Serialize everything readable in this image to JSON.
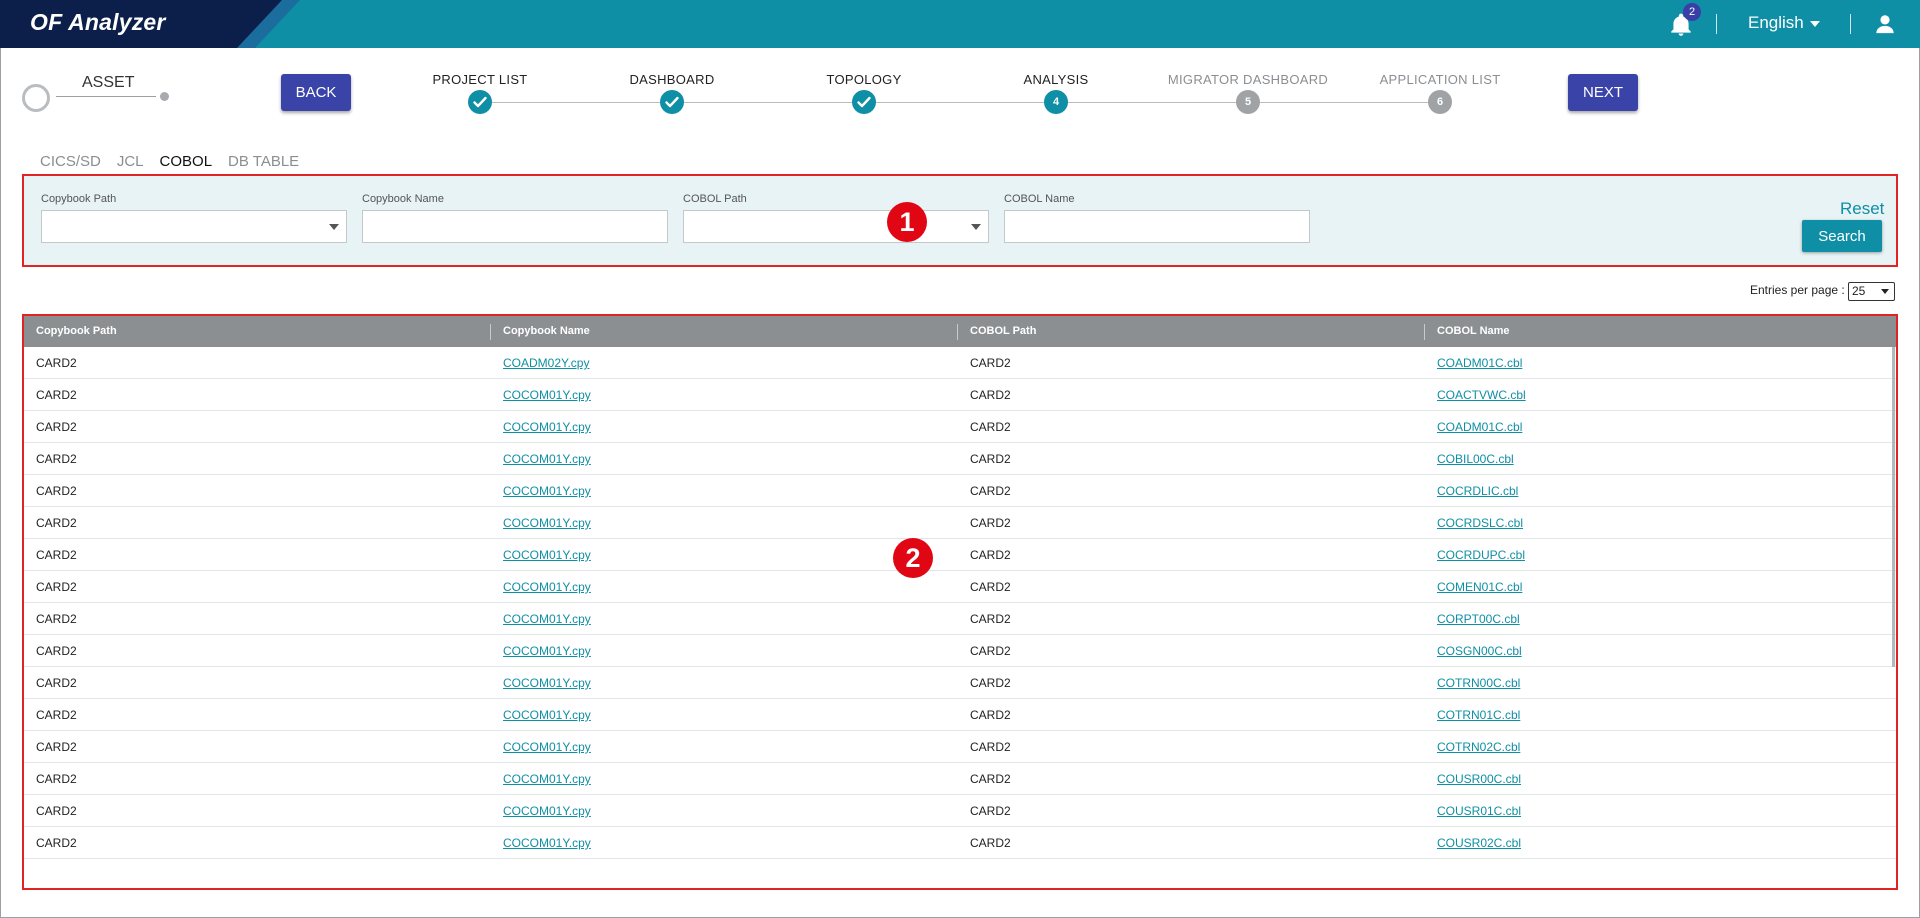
{
  "header": {
    "app_title": "OF Analyzer",
    "notification_count": "2",
    "language": "English",
    "colors": {
      "header_bg": "#0e8fa5",
      "logo_bg": "#0c1f4a",
      "accent": "#0e8fa5",
      "button": "#3a44a8"
    }
  },
  "nav": {
    "asset_label": "ASSET",
    "back_label": "BACK",
    "next_label": "NEXT",
    "steps": [
      {
        "label": "PROJECT LIST",
        "state": "done",
        "mark": ""
      },
      {
        "label": "DASHBOARD",
        "state": "done",
        "mark": ""
      },
      {
        "label": "TOPOLOGY",
        "state": "done",
        "mark": ""
      },
      {
        "label": "ANALYSIS",
        "state": "active",
        "mark": "4"
      },
      {
        "label": "MIGRATOR DASHBOARD",
        "state": "pending",
        "mark": "5"
      },
      {
        "label": "APPLICATION LIST",
        "state": "pending",
        "mark": "6"
      }
    ]
  },
  "tabs": [
    "CICS/SD",
    "JCL",
    "COBOL",
    "DB TABLE"
  ],
  "active_tab": "COBOL",
  "filter": {
    "copybook_path_label": "Copybook Path",
    "copybook_path_value": "",
    "copybook_name_label": "Copybook Name",
    "copybook_name_value": "",
    "cobol_path_label": "COBOL Path",
    "cobol_path_value": "",
    "cobol_name_label": "COBOL Name",
    "cobol_name_value": "",
    "reset_label": "Reset",
    "search_label": "Search"
  },
  "markers": {
    "filter": "1",
    "table": "2"
  },
  "entries": {
    "label": "Entries per page :",
    "value": "25"
  },
  "table": {
    "columns": [
      "Copybook Path",
      "Copybook Name",
      "COBOL Path",
      "COBOL Name"
    ],
    "rows": [
      [
        "CARD2",
        "COADM02Y.cpy",
        "CARD2",
        "COADM01C.cbl"
      ],
      [
        "CARD2",
        "COCOM01Y.cpy",
        "CARD2",
        "COACTVWC.cbl"
      ],
      [
        "CARD2",
        "COCOM01Y.cpy",
        "CARD2",
        "COADM01C.cbl"
      ],
      [
        "CARD2",
        "COCOM01Y.cpy",
        "CARD2",
        "COBIL00C.cbl"
      ],
      [
        "CARD2",
        "COCOM01Y.cpy",
        "CARD2",
        "COCRDLIC.cbl"
      ],
      [
        "CARD2",
        "COCOM01Y.cpy",
        "CARD2",
        "COCRDSLC.cbl"
      ],
      [
        "CARD2",
        "COCOM01Y.cpy",
        "CARD2",
        "COCRDUPC.cbl"
      ],
      [
        "CARD2",
        "COCOM01Y.cpy",
        "CARD2",
        "COMEN01C.cbl"
      ],
      [
        "CARD2",
        "COCOM01Y.cpy",
        "CARD2",
        "CORPT00C.cbl"
      ],
      [
        "CARD2",
        "COCOM01Y.cpy",
        "CARD2",
        "COSGN00C.cbl"
      ],
      [
        "CARD2",
        "COCOM01Y.cpy",
        "CARD2",
        "COTRN00C.cbl"
      ],
      [
        "CARD2",
        "COCOM01Y.cpy",
        "CARD2",
        "COTRN01C.cbl"
      ],
      [
        "CARD2",
        "COCOM01Y.cpy",
        "CARD2",
        "COTRN02C.cbl"
      ],
      [
        "CARD2",
        "COCOM01Y.cpy",
        "CARD2",
        "COUSR00C.cbl"
      ],
      [
        "CARD2",
        "COCOM01Y.cpy",
        "CARD2",
        "COUSR01C.cbl"
      ],
      [
        "CARD2",
        "COCOM01Y.cpy",
        "CARD2",
        "COUSR02C.cbl"
      ]
    ]
  }
}
